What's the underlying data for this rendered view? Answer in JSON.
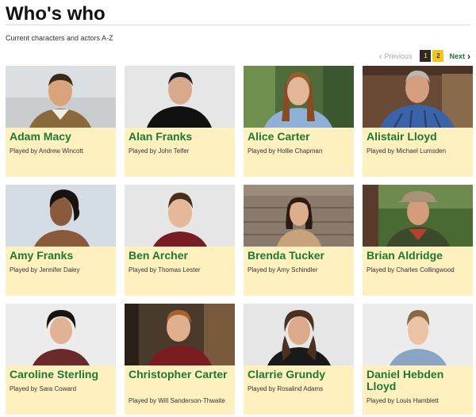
{
  "header": {
    "title": "Who's who",
    "subtitle": "Current characters and actors A-Z"
  },
  "pager": {
    "previous_label": "Previous",
    "pages": [
      "1",
      "2"
    ],
    "current_page": "1",
    "next_label": "Next"
  },
  "characters": [
    {
      "name": "Adam Macy",
      "actor": "Played by Andrew Wincott"
    },
    {
      "name": "Alan Franks",
      "actor": "Played by John Telfer"
    },
    {
      "name": "Alice Carter",
      "actor": "Played by Hollie Chapman"
    },
    {
      "name": "Alistair Lloyd",
      "actor": "Played by Michael Lumsden"
    },
    {
      "name": "Amy Franks",
      "actor": "Played by Jennifer Daley"
    },
    {
      "name": "Ben Archer",
      "actor": "Played by Thomas Lester"
    },
    {
      "name": "Brenda Tucker",
      "actor": "Played by Amy Schindler"
    },
    {
      "name": "Brian Aldridge",
      "actor": "Played by Charles Collingwood"
    },
    {
      "name": "Caroline Sterling",
      "actor": "Played by Sara Coward"
    },
    {
      "name": "Christopher Carter",
      "actor": "Played by Will Sanderson-Thwaite"
    },
    {
      "name": "Clarrie Grundy",
      "actor": "Played by Rosalind Adams"
    },
    {
      "name": "Daniel Hebden Lloyd",
      "actor": "Played by Louis Hamblett"
    }
  ],
  "colors": {
    "card_background": "#fff0c0",
    "name_green": "#1b7a30",
    "pager_current": "#2a2a2a",
    "pager_other": "#f5c518"
  }
}
